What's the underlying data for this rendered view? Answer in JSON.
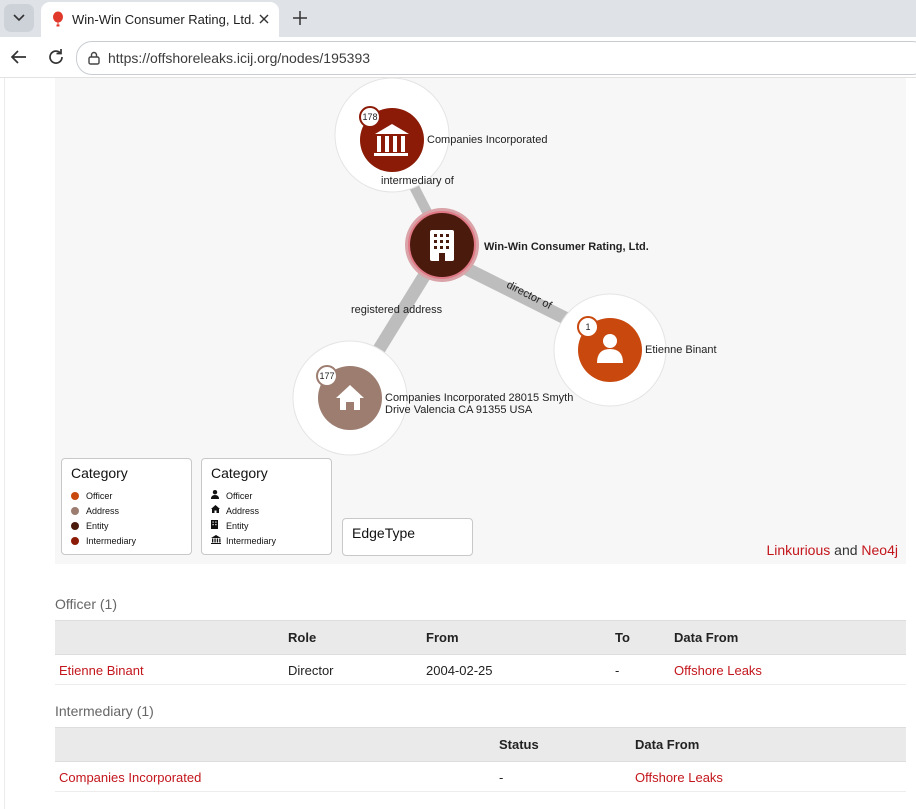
{
  "browser": {
    "tab_title": "Win-Win Consumer Rating, Ltd. | I",
    "url": "https://offshoreleaks.icij.org/nodes/195393"
  },
  "graph": {
    "nodes": {
      "center": {
        "label": "Win-Win Consumer Rating, Ltd.",
        "type": "Entity",
        "color": "#4a1a0d"
      },
      "intermediary": {
        "label": "Companies Incorporated",
        "count": "178",
        "type": "Intermediary",
        "color": "#8b1a06"
      },
      "officer": {
        "label": "Etienne Binant",
        "count": "1",
        "type": "Officer",
        "color": "#c8480e"
      },
      "address": {
        "label_line1": "Companies Incorporated 28015 Smyth",
        "label_line2": "Drive Valencia CA 91355 USA",
        "count": "177",
        "type": "Address",
        "color": "#9c7d70"
      }
    },
    "edges": {
      "intermediary": "intermediary of",
      "officer": "director of",
      "address": "registered address"
    },
    "legend_colors": {
      "title": "Category",
      "items": [
        {
          "label": "Officer",
          "color": "#c8480e"
        },
        {
          "label": "Address",
          "color": "#9c7d70"
        },
        {
          "label": "Entity",
          "color": "#4a1a0d"
        },
        {
          "label": "Intermediary",
          "color": "#8b1a06"
        }
      ]
    },
    "legend_icons": {
      "title": "Category",
      "items": [
        {
          "label": "Officer",
          "icon": "person-icon"
        },
        {
          "label": "Address",
          "icon": "home-icon"
        },
        {
          "label": "Entity",
          "icon": "building-icon"
        },
        {
          "label": "Intermediary",
          "icon": "institution-icon"
        }
      ]
    },
    "legend_edges": {
      "title": "EdgeType"
    },
    "credit": {
      "link1": "Linkurious",
      "and": "and",
      "link2": "Neo4j"
    }
  },
  "officer_section": {
    "title": "Officer (1)",
    "headers": [
      "",
      "Role",
      "From",
      "To",
      "Data From"
    ],
    "rows": [
      {
        "name": "Etienne Binant",
        "role": "Director",
        "from": "2004-02-25",
        "to": "-",
        "data_from": "Offshore Leaks"
      }
    ]
  },
  "intermediary_section": {
    "title": "Intermediary (1)",
    "headers": [
      "",
      "Status",
      "Data From"
    ],
    "rows": [
      {
        "name": "Companies Incorporated",
        "status": "-",
        "data_from": "Offshore Leaks"
      }
    ]
  }
}
